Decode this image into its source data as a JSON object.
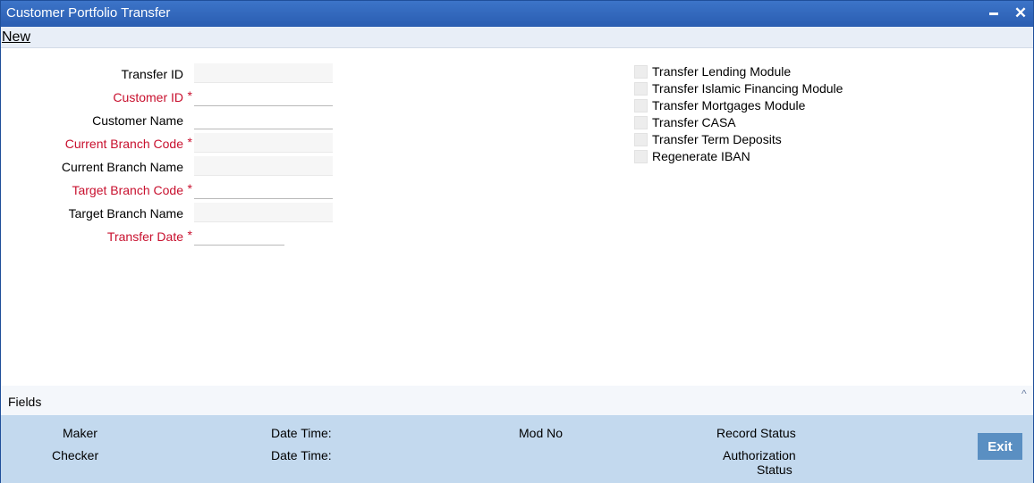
{
  "window": {
    "title": "Customer Portfolio Transfer",
    "minimize_label": "",
    "close_label": "✕"
  },
  "toolbar": {
    "new_label": "New"
  },
  "form": {
    "fields": [
      {
        "label": "Transfer ID",
        "required": false,
        "value": ""
      },
      {
        "label": "Customer ID",
        "required": true,
        "value": ""
      },
      {
        "label": "Customer Name",
        "required": false,
        "value": ""
      },
      {
        "label": "Current Branch Code",
        "required": true,
        "value": ""
      },
      {
        "label": "Current Branch Name",
        "required": false,
        "value": ""
      },
      {
        "label": "Target Branch Code",
        "required": true,
        "value": ""
      },
      {
        "label": "Target Branch Name",
        "required": false,
        "value": ""
      },
      {
        "label": "Transfer Date",
        "required": true,
        "value": ""
      }
    ],
    "required_marker": "*"
  },
  "checkboxes": [
    {
      "label": "Transfer Lending Module",
      "checked": false
    },
    {
      "label": "Transfer Islamic Financing Module",
      "checked": false
    },
    {
      "label": "Transfer Mortgages Module",
      "checked": false
    },
    {
      "label": "Transfer CASA",
      "checked": false
    },
    {
      "label": "Transfer Term Deposits",
      "checked": false
    },
    {
      "label": "Regenerate IBAN",
      "checked": false
    }
  ],
  "fields_section": {
    "title": "Fields",
    "collapse_icon": "chevron-up-icon"
  },
  "footer": {
    "maker": "Maker",
    "checker": "Checker",
    "date_time_1": "Date Time:",
    "date_time_2": "Date Time:",
    "mod_no": "Mod No",
    "record_status": "Record Status",
    "authorization_status_line1": "Authorization",
    "authorization_status_line2": "Status",
    "exit_label": "Exit"
  },
  "colors": {
    "titlebar": "#2a5db1",
    "required_label": "#c8102e",
    "footer_bg": "#c3d9ee",
    "exit_button": "#5a8fc2"
  }
}
